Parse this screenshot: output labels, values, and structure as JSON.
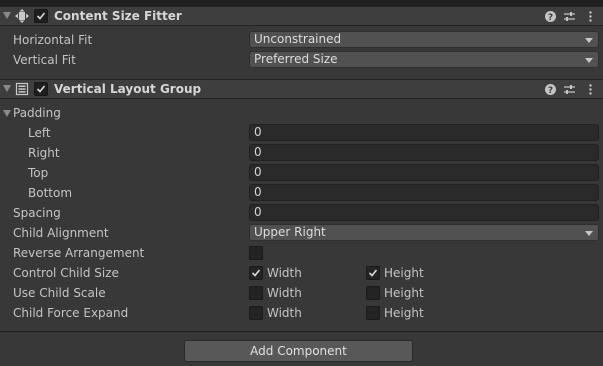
{
  "content_size_fitter": {
    "title": "Content Size Fitter",
    "enabled": true,
    "horizontal_fit": {
      "label": "Horizontal Fit",
      "value": "Unconstrained"
    },
    "vertical_fit": {
      "label": "Vertical Fit",
      "value": "Preferred Size"
    }
  },
  "vertical_layout_group": {
    "title": "Vertical Layout Group",
    "enabled": true,
    "padding": {
      "label": "Padding",
      "left": {
        "label": "Left",
        "value": "0"
      },
      "right": {
        "label": "Right",
        "value": "0"
      },
      "top": {
        "label": "Top",
        "value": "0"
      },
      "bottom": {
        "label": "Bottom",
        "value": "0"
      }
    },
    "spacing": {
      "label": "Spacing",
      "value": "0"
    },
    "child_alignment": {
      "label": "Child Alignment",
      "value": "Upper Right"
    },
    "reverse_arrangement": {
      "label": "Reverse Arrangement",
      "checked": false
    },
    "control_child_size": {
      "label": "Control Child Size",
      "width_label": "Width",
      "height_label": "Height",
      "width": true,
      "height": true
    },
    "use_child_scale": {
      "label": "Use Child Scale",
      "width_label": "Width",
      "height_label": "Height",
      "width": false,
      "height": false
    },
    "child_force_expand": {
      "label": "Child Force Expand",
      "width_label": "Width",
      "height_label": "Height",
      "width": false,
      "height": false
    }
  },
  "add_component": {
    "label": "Add Component"
  },
  "icons": {
    "fitter": "content-size-fitter-icon",
    "layout": "vertical-layout-icon",
    "help": "help-icon",
    "presets": "presets-icon",
    "menu": "more-vertical-icon"
  }
}
